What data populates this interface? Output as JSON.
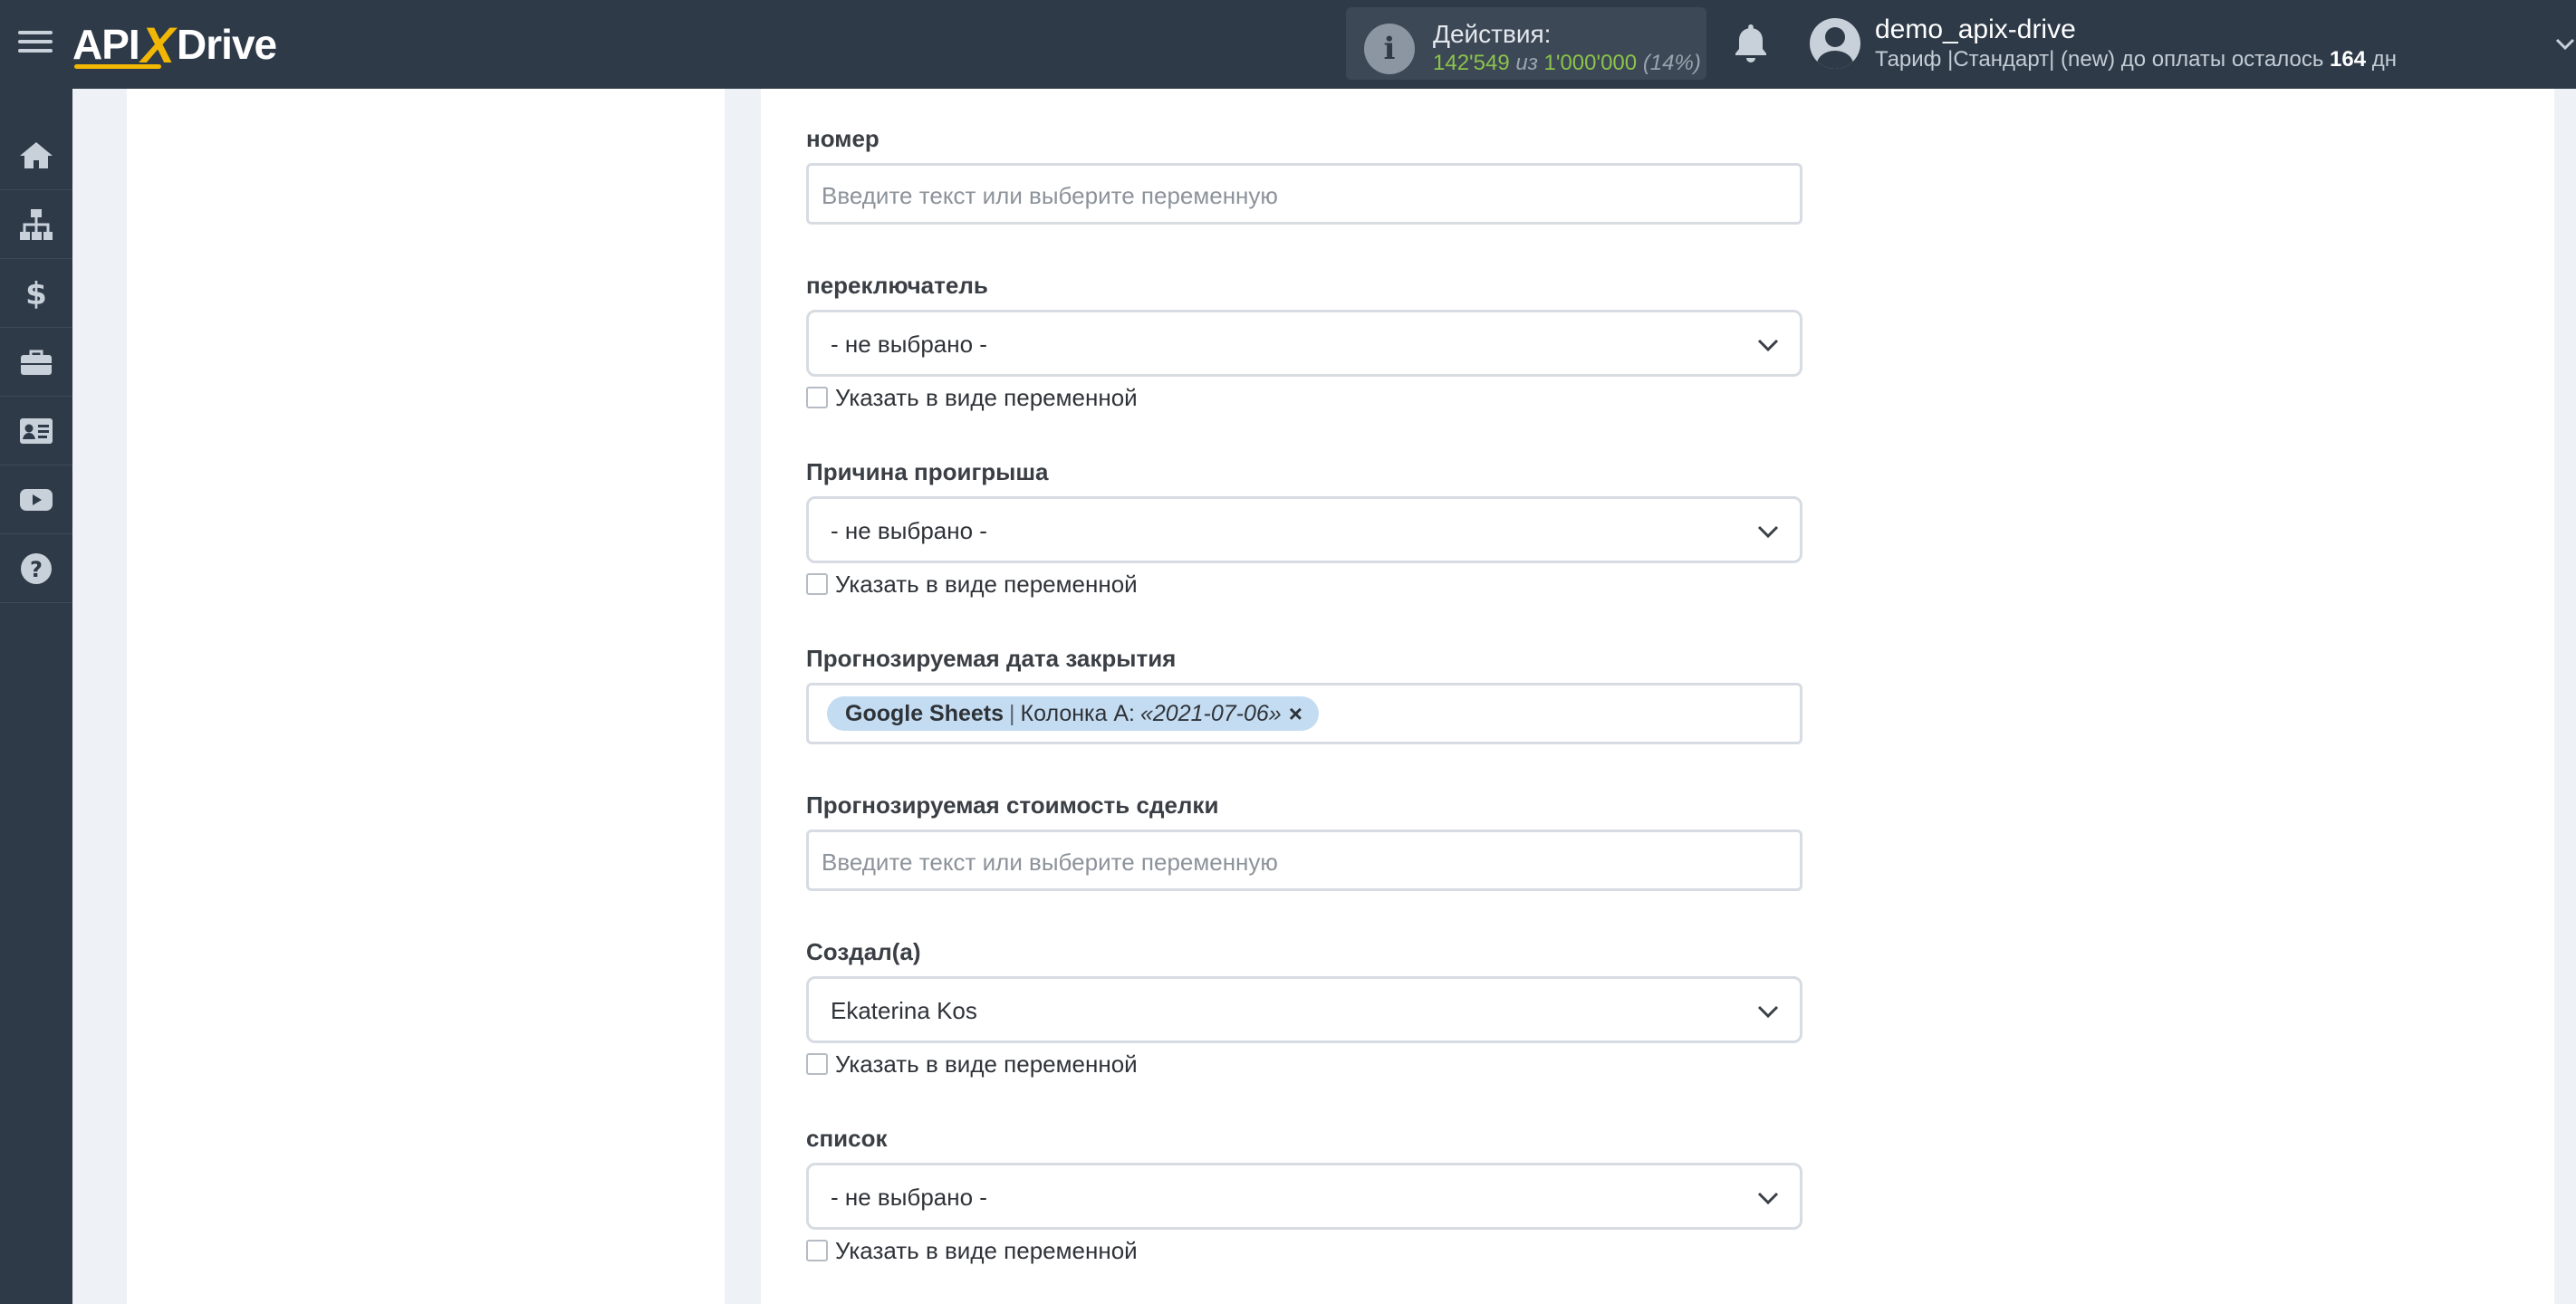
{
  "header": {
    "logo": {
      "left": "API",
      "x": "X",
      "right": "Drive"
    },
    "actions": {
      "label": "Действия:",
      "used": "142'549",
      "of": "из",
      "total": "1'000'000",
      "extra": "(14%)"
    },
    "user": {
      "name": "demo_apix-drive",
      "plan_prefix": "Тариф |Стандарт| (new) до оплаты осталось",
      "days": "164",
      "days_suffix": "дн"
    },
    "colors": {
      "bar": "#2e3a48",
      "accent": "#f2b705",
      "count": "#8bc34a"
    }
  },
  "sidebar": {
    "items": [
      {
        "icon": "home-icon"
      },
      {
        "icon": "sitemap-icon"
      },
      {
        "icon": "dollar-icon"
      },
      {
        "icon": "briefcase-icon"
      },
      {
        "icon": "contact-card-icon"
      },
      {
        "icon": "youtube-icon"
      },
      {
        "icon": "help-icon"
      }
    ]
  },
  "form": {
    "nomer": {
      "label": "номер",
      "placeholder": "Введите текст или выберите переменную"
    },
    "switch": {
      "label": "переключатель",
      "value": "- не выбрано -",
      "checkbox": "Указать в виде переменной"
    },
    "loss_reason": {
      "label": "Причина проигрыша",
      "value": "- не выбрано -",
      "checkbox": "Указать в виде переменной"
    },
    "close_date": {
      "label": "Прогнозируемая дата закрытия",
      "tag": {
        "source": "Google Sheets",
        "separator": "|",
        "column": "Колонка А:",
        "value": "«2021-07-06»",
        "remove": "×"
      }
    },
    "deal_value": {
      "label": "Прогнозируемая стоимость сделки",
      "placeholder": "Введите текст или выберите переменную"
    },
    "created_by": {
      "label": "Создал(а)",
      "value": "Ekaterina Kos",
      "checkbox": "Указать в виде переменной"
    },
    "list": {
      "label": "список",
      "value": "- не выбрано -",
      "checkbox": "Указать в виде переменной"
    }
  }
}
